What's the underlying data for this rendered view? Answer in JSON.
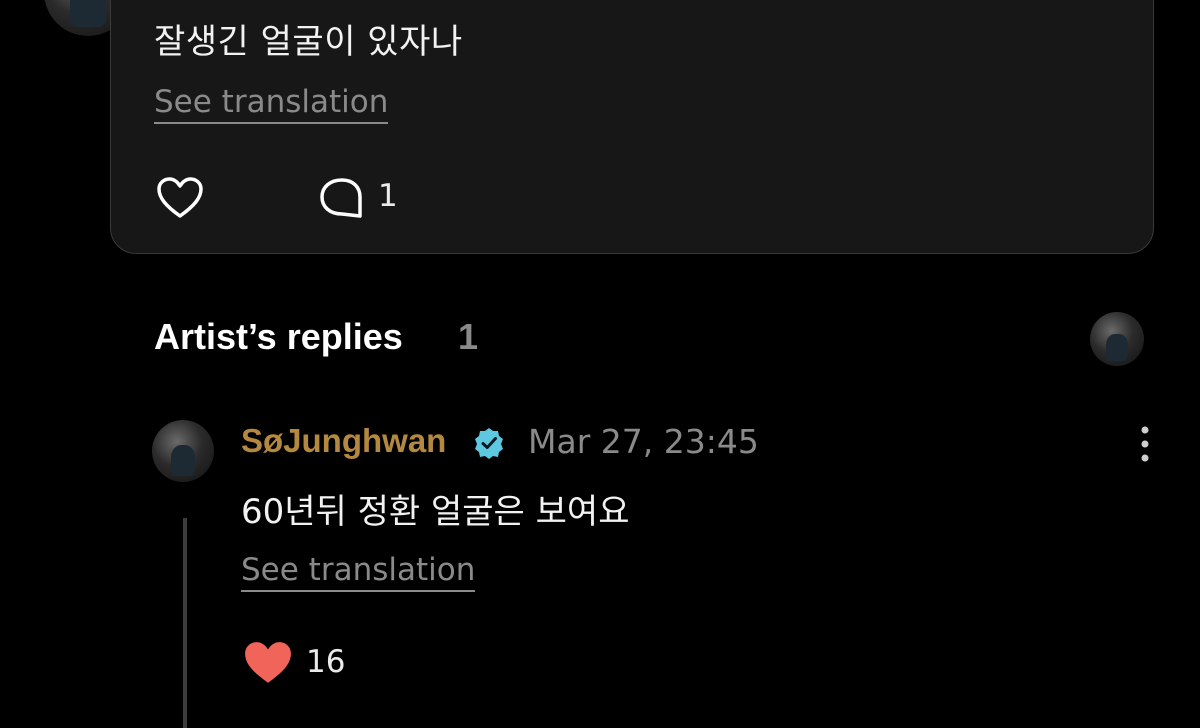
{
  "post": {
    "text": "잘생긴 얼굴이 있자나",
    "see_translation": "See translation",
    "comment_count": "1",
    "icons": {
      "like": "heart-outline-icon",
      "comment": "comment-bubble-icon"
    }
  },
  "artist_replies": {
    "title": "Artist’s replies",
    "count": "1"
  },
  "reply": {
    "author": "SøJunghwan",
    "timestamp": "Mar 27, 23:45",
    "text": "60년뒤 정환 얼굴은 보여요",
    "see_translation": "See translation",
    "like_count": "16",
    "icons": {
      "verified": "verified-badge-icon",
      "more": "more-vertical-icon",
      "like": "heart-filled-icon"
    }
  },
  "colors": {
    "background": "#000000",
    "card": "#171717",
    "author": "#b4893f",
    "muted": "#8a8a8a",
    "heart": "#f0645a",
    "verified": "#5ec8e0"
  }
}
